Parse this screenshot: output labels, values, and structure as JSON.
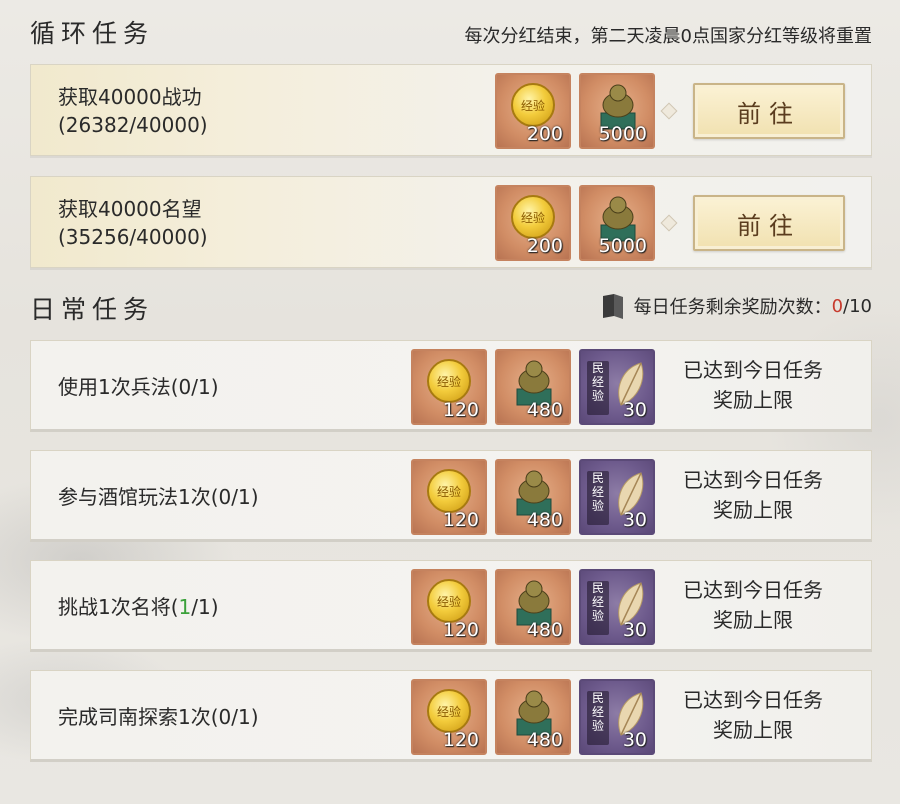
{
  "loop_section": {
    "title": "循环任务",
    "note": "每次分红结束，第二天凌晨0点国家分红等级将重置",
    "tasks": [
      {
        "name": "获取40000战功",
        "progress": "(26382/40000)",
        "rewards": [
          "200",
          "5000"
        ],
        "button": "前往"
      },
      {
        "name": "获取40000名望",
        "progress": "(35256/40000)",
        "rewards": [
          "200",
          "5000"
        ],
        "button": "前往"
      }
    ]
  },
  "daily_section": {
    "title": "日常任务",
    "remaining_label": "每日任务剩余奖励次数：",
    "remaining_current": "0",
    "remaining_total": "/10",
    "reward_coin_label": "经验",
    "minjing_label": [
      "民",
      "经",
      "验"
    ],
    "tasks": [
      {
        "name_prefix": "使用1次兵法(",
        "done": "0",
        "name_suffix": "/1)",
        "rewards": [
          "120",
          "480",
          "30"
        ],
        "status": [
          "已达到今日任务",
          "奖励上限"
        ]
      },
      {
        "name_prefix": "参与酒馆玩法1次(",
        "done": "0",
        "name_suffix": "/1)",
        "rewards": [
          "120",
          "480",
          "30"
        ],
        "status": [
          "已达到今日任务",
          "奖励上限"
        ]
      },
      {
        "name_prefix": "挑战1次名将(",
        "done": "1",
        "name_suffix": "/1)",
        "rewards": [
          "120",
          "480",
          "30"
        ],
        "status": [
          "已达到今日任务",
          "奖励上限"
        ]
      },
      {
        "name_prefix": "完成司南探索1次(",
        "done": "0",
        "name_suffix": "/1)",
        "rewards": [
          "120",
          "480",
          "30"
        ],
        "status": [
          "已达到今日任务",
          "奖励上限"
        ]
      }
    ]
  },
  "colors": {
    "red": "#c73a2d",
    "green": "#3aa13a",
    "copper": "#d18d65",
    "purple": "#6d5a8c"
  }
}
